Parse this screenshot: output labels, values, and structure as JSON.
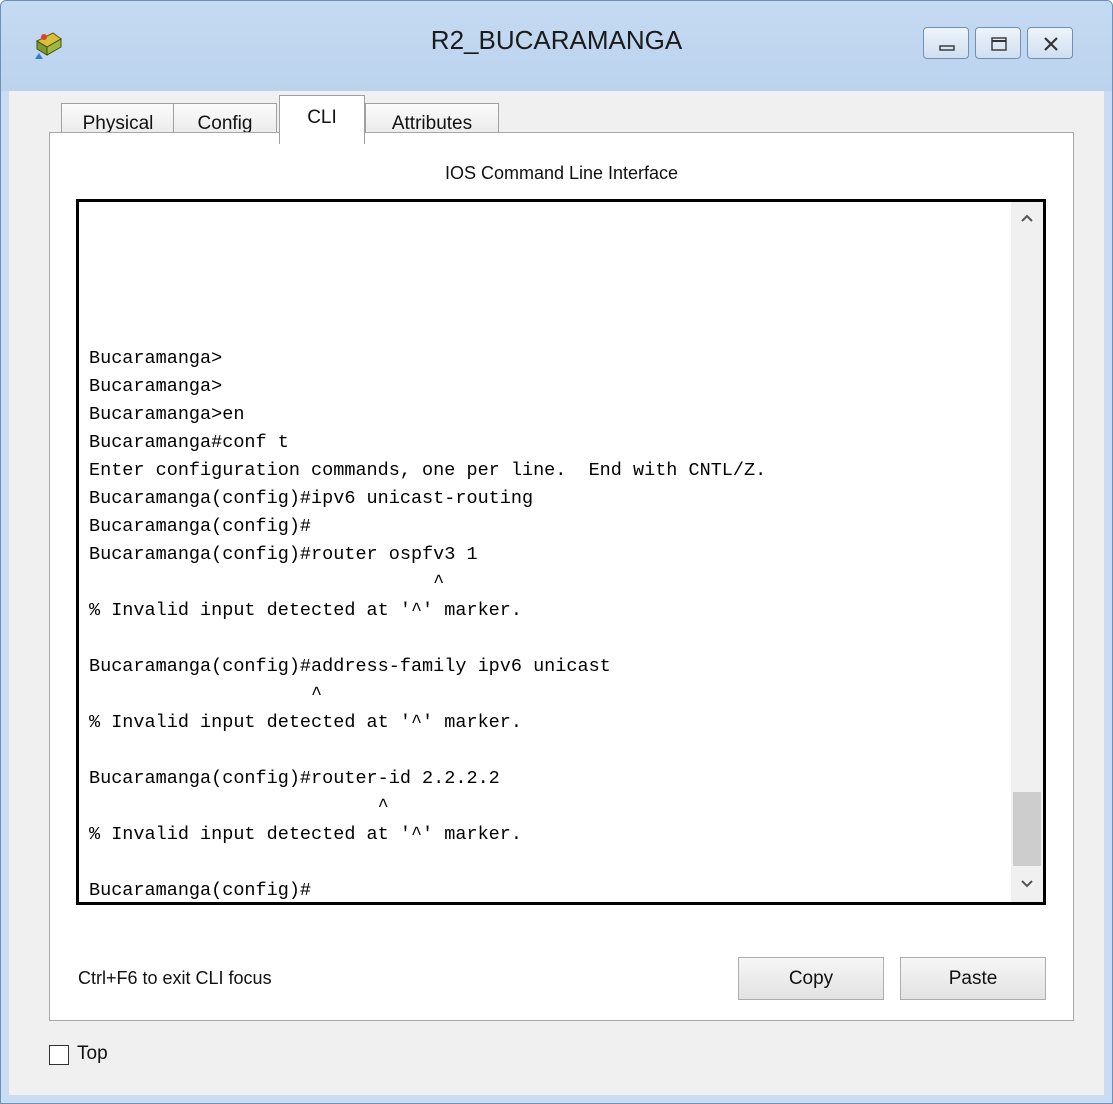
{
  "window": {
    "title": "R2_BUCARAMANGA",
    "icon": "packet-tracer-router-icon",
    "controls": [
      "minimize-icon",
      "maximize-icon",
      "close-icon"
    ]
  },
  "tabs": [
    {
      "label": "Physical",
      "active": false
    },
    {
      "label": "Config",
      "active": false
    },
    {
      "label": "CLI",
      "active": true
    },
    {
      "label": "Attributes",
      "active": false
    }
  ],
  "panel": {
    "title": "IOS Command Line Interface",
    "cli_lines": [
      "Bucaramanga>",
      "Bucaramanga>",
      "Bucaramanga>en",
      "Bucaramanga#conf t",
      "Enter configuration commands, one per line.  End with CNTL/Z.",
      "Bucaramanga(config)#ipv6 unicast-routing",
      "Bucaramanga(config)#",
      "Bucaramanga(config)#router ospfv3 1",
      "                               ^",
      "% Invalid input detected at '^' marker.",
      "",
      "Bucaramanga(config)#address-family ipv6 unicast",
      "                    ^",
      "% Invalid input detected at '^' marker.",
      "",
      "Bucaramanga(config)#router-id 2.2.2.2",
      "                          ^",
      "% Invalid input detected at '^' marker.",
      "",
      "Bucaramanga(config)#"
    ],
    "hint": "Ctrl+F6 to exit CLI focus",
    "copy_label": "Copy",
    "paste_label": "Paste"
  },
  "top_checkbox": {
    "label": "Top",
    "checked": false
  }
}
